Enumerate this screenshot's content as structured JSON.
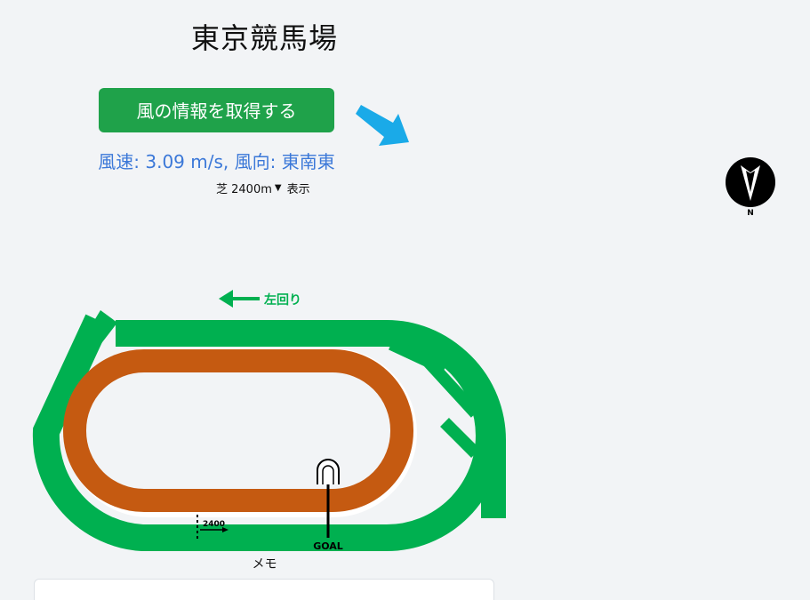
{
  "header": {
    "title": "東京競馬場"
  },
  "controls": {
    "fetch_button_label": "風の情報を取得する",
    "wind_info": "風速: 3.09 m/s, 風向: 東南東",
    "wind_arrow_icon": "arrow-icon",
    "course_select": {
      "selected": "芝 2400m"
    },
    "show_label": "表示"
  },
  "compass": {
    "north_label": "N",
    "icon": "compass-icon"
  },
  "track": {
    "direction_label": "左回り",
    "distance_marker_label": "2400",
    "goal_label": "GOAL",
    "colors": {
      "turf": "#00b050",
      "dirt": "#c55a11",
      "arrow": "#00b050"
    }
  },
  "memo": {
    "label": "メモ"
  },
  "colors": {
    "button": "#1fa24a",
    "wind_text": "#3b78d8",
    "wind_arrow": "#1aaae8",
    "background": "#f2f4f6"
  }
}
